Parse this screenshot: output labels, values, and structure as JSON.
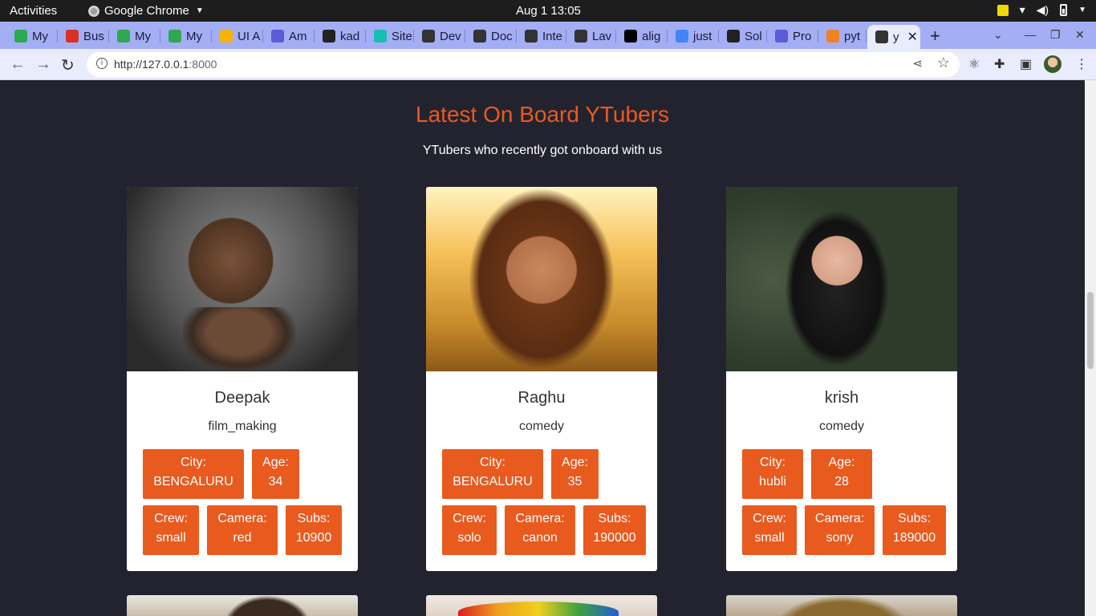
{
  "topbar": {
    "activities": "Activities",
    "app_name": "Google Chrome",
    "clock": "Aug 1  13:05"
  },
  "tabs": [
    {
      "label": "My",
      "icon": "drive-icon",
      "color": "#2da94f"
    },
    {
      "label": "Bus",
      "icon": "gmail-icon",
      "color": "#d93025"
    },
    {
      "label": "My",
      "icon": "drive-icon",
      "color": "#2da94f"
    },
    {
      "label": "My",
      "icon": "drive-icon",
      "color": "#2da94f"
    },
    {
      "label": "UI A",
      "icon": "w-icon",
      "color": "#f4b400"
    },
    {
      "label": "Am",
      "icon": "devto-icon",
      "color": "#5b5bd6"
    },
    {
      "label": "kad",
      "icon": "github-icon",
      "color": "#222222"
    },
    {
      "label": "Site",
      "icon": "diamond-icon",
      "color": "#16c0b0"
    },
    {
      "label": "Dev",
      "icon": "globe-icon",
      "color": "#333333"
    },
    {
      "label": "Doc",
      "icon": "globe-icon",
      "color": "#333333"
    },
    {
      "label": "Inte",
      "icon": "globe-icon",
      "color": "#333333"
    },
    {
      "label": "Lav",
      "icon": "globe-icon",
      "color": "#333333"
    },
    {
      "label": "alig",
      "icon": "medium-icon",
      "color": "#000000"
    },
    {
      "label": "just",
      "icon": "google-icon",
      "color": "#4285f4"
    },
    {
      "label": "Sol",
      "icon": "github-icon",
      "color": "#222222"
    },
    {
      "label": "Pro",
      "icon": "devto-icon",
      "color": "#5b5bd6"
    },
    {
      "label": "pyt",
      "icon": "stackoverflow-icon",
      "color": "#f48024"
    },
    {
      "label": "y",
      "icon": "globe-icon",
      "color": "#333333",
      "active": true
    }
  ],
  "address_bar": {
    "url_host": "http://127.0.0.1",
    "url_port": ":8000"
  },
  "section": {
    "title": "Latest On Board YTubers",
    "subtitle": "YTubers who recently got onboard with us"
  },
  "accent_color": "#e95a1f",
  "cards": [
    {
      "name": "Deepak",
      "category": "film_making",
      "city_label": "City:",
      "city": "BENGALURU",
      "age_label": "Age:",
      "age": "34",
      "crew_label": "Crew:",
      "crew": "small",
      "camera_label": "Camera:",
      "camera": "red",
      "subs_label": "Subs:",
      "subs": "10900"
    },
    {
      "name": "Raghu",
      "category": "comedy",
      "city_label": "City:",
      "city": "BENGALURU",
      "age_label": "Age:",
      "age": "35",
      "crew_label": "Crew:",
      "crew": "solo",
      "camera_label": "Camera:",
      "camera": "canon",
      "subs_label": "Subs:",
      "subs": "190000"
    },
    {
      "name": "krish",
      "category": "comedy",
      "city_label": "City:",
      "city": "hubli",
      "age_label": "Age:",
      "age": "28",
      "crew_label": "Crew:",
      "crew": "small",
      "camera_label": "Camera:",
      "camera": "sony",
      "subs_label": "Subs:",
      "subs": "189000"
    }
  ]
}
